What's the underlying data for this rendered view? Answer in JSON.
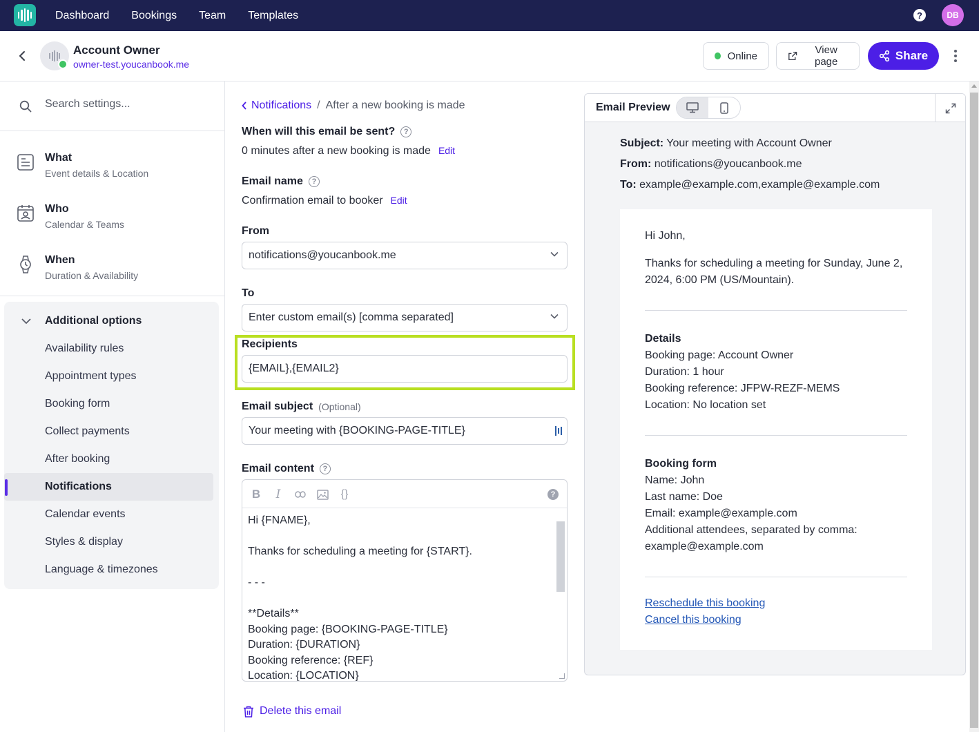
{
  "topnav": {
    "items": [
      "Dashboard",
      "Bookings",
      "Team",
      "Templates"
    ],
    "help_glyph": "?",
    "avatar_initials": "DB"
  },
  "header": {
    "owner_name": "Account Owner",
    "owner_url": "owner-test.youcanbook.me",
    "status_label": "Online",
    "view_page_label": "View page",
    "share_label": "Share"
  },
  "sidebar": {
    "search_placeholder": "Search settings...",
    "sections": [
      {
        "title": "What",
        "subtitle": "Event details & Location",
        "icon": "document-icon"
      },
      {
        "title": "Who",
        "subtitle": "Calendar & Teams",
        "icon": "contact-card-icon"
      },
      {
        "title": "When",
        "subtitle": "Duration & Availability",
        "icon": "watch-icon"
      }
    ],
    "additional_title": "Additional options",
    "additional_items": [
      "Availability rules",
      "Appointment types",
      "Booking form",
      "Collect payments",
      "After booking",
      "Notifications",
      "Calendar events",
      "Styles & display",
      "Language & timezones"
    ],
    "active_item": "Notifications"
  },
  "form": {
    "breadcrumb_link": "Notifications",
    "breadcrumb_sep": "/",
    "breadcrumb_current": "After a new booking is made",
    "when_label": "When will this email be sent?",
    "when_value": "0 minutes after a new booking is made",
    "edit_label": "Edit",
    "name_label": "Email name",
    "name_value": "Confirmation email to booker",
    "from_label": "From",
    "from_value": "notifications@youcanbook.me",
    "to_label": "To",
    "to_value": "Enter custom email(s) [comma separated]",
    "recipients_label": "Recipients",
    "recipients_value": "{EMAIL},{EMAIL2}",
    "subject_label": "Email subject",
    "subject_optional": "(Optional)",
    "subject_value": "Your meeting with {BOOKING-PAGE-TITLE}",
    "content_label": "Email content",
    "content_value": "Hi {FNAME},\n\nThanks for scheduling a meeting for {START}.\n\n- - -\n\n**Details**\nBooking page: {BOOKING-PAGE-TITLE}\nDuration: {DURATION}\nBooking reference: {REF}\nLocation: {LOCATION}",
    "toolbar": {
      "bold": "B",
      "italic": "I",
      "braces": "{}",
      "help": "?"
    },
    "delete_label": "Delete this email"
  },
  "preview": {
    "title": "Email Preview",
    "subject_key": "Subject:",
    "subject_value": "Your meeting with Account Owner",
    "from_key": "From:",
    "from_value": "notifications@youcanbook.me",
    "to_key": "To:",
    "to_value": "example@example.com,example@example.com",
    "greeting": "Hi John,",
    "intro": "Thanks for scheduling a meeting for Sunday, June 2, 2024, 6:00 PM (US/Mountain).",
    "details_title": "Details",
    "details_lines": [
      "Booking page: Account Owner",
      "Duration: 1 hour",
      "Booking reference: JFPW-REZF-MEMS",
      "Location: No location set"
    ],
    "form_title": "Booking form",
    "form_lines": [
      "Name: John",
      "Last name: Doe",
      "Email: example@example.com",
      "Additional attendees, separated by comma: example@example.com"
    ],
    "reschedule_label": "Reschedule this booking",
    "cancel_label": "Cancel this booking"
  },
  "colors": {
    "nav_bg": "#1d2150",
    "accent": "#4c1fe6",
    "highlight": "#b9df22",
    "online": "#40c463"
  }
}
